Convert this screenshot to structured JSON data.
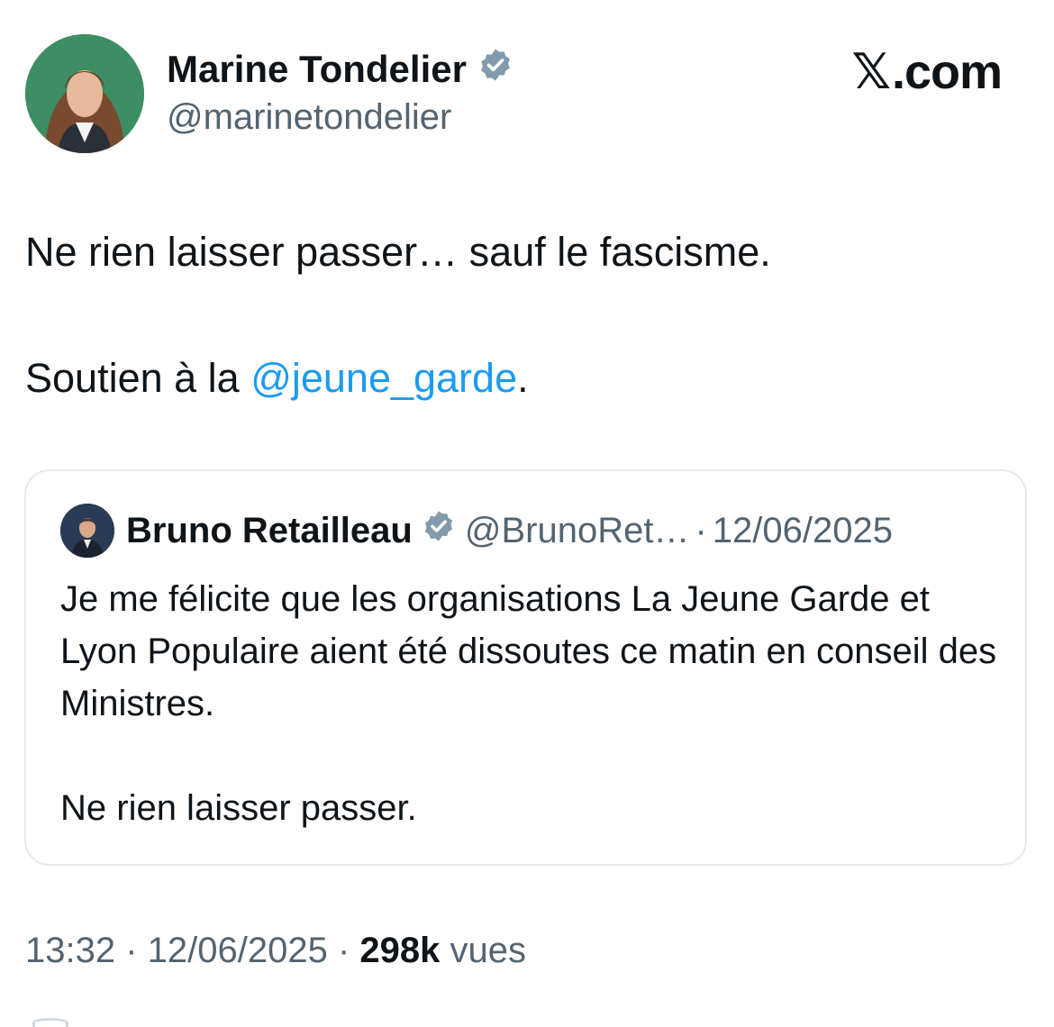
{
  "author": {
    "name": "Marine Tondelier",
    "handle": "@marinetondelier",
    "verified": true,
    "avatar_bg": "#3e8e64"
  },
  "site": {
    "logo_mark": "𝕏",
    "logo_text": ".com"
  },
  "tweet": {
    "line1": "Ne rien laisser passer… sauf le fascisme.",
    "line2_prefix": "Soutien à la ",
    "mention": "@jeune_garde",
    "line2_suffix": "."
  },
  "quoted": {
    "name": "Bruno Retailleau",
    "handle": "@BrunoRet…",
    "separator": "·",
    "date": "12/06/2025",
    "verified": true,
    "text_p1": "Je me félicite que les organisations La Jeune Garde et Lyon Populaire aient été dissoutes ce matin en conseil des Ministres.",
    "text_p2": "Ne rien laisser passer."
  },
  "meta": {
    "time": "13:32",
    "sep1": " · ",
    "date": "12/06/2025",
    "sep2": " · ",
    "views_count": "298k",
    "views_label": " vues"
  },
  "colors": {
    "link": "#1d9bf0",
    "muted": "#536471",
    "verified_badge": "#829aab"
  },
  "icons": [
    "verified-badge-icon",
    "x-logo-icon"
  ]
}
